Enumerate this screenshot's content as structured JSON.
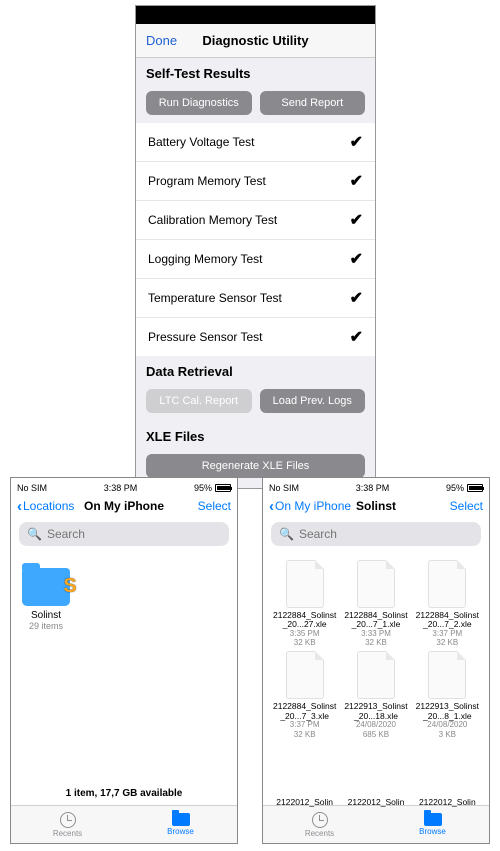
{
  "diag": {
    "done": "Done",
    "title": "Diagnostic Utility",
    "section1": "Self-Test Results",
    "run_btn": "Run Diagnostics",
    "send_btn": "Send Report",
    "tests": [
      "Battery Voltage Test",
      "Program Memory Test",
      "Calibration Memory Test",
      "Logging Memory Test",
      "Temperature Sensor Test",
      "Pressure Sensor Test"
    ],
    "check": "✔",
    "section2": "Data Retrieval",
    "ltc_btn": "LTC Cal. Report",
    "load_btn": "Load Prev. Logs",
    "section3": "XLE Files",
    "regen_btn": "Regenerate XLE Files"
  },
  "status": {
    "sim": "No SIM",
    "time": "3:38 PM",
    "batt": "95%"
  },
  "filesLeft": {
    "back": "Locations",
    "title": "On My iPhone",
    "select": "Select",
    "search_ph": "Search",
    "folder_name": "Solinst",
    "folder_count": "29 items",
    "footer": "1 item, 17,7 GB available"
  },
  "filesRight": {
    "back": "On My iPhone",
    "title": "Solinst",
    "select": "Select",
    "search_ph": "Search",
    "files": [
      {
        "name": "2122884_Solinst_20...27.xle",
        "meta": "3:35 PM",
        "size": "32 KB"
      },
      {
        "name": "2122884_Solinst_20...7_1.xle",
        "meta": "3:33 PM",
        "size": "32 KB"
      },
      {
        "name": "2122884_Solinst_20...7_2.xle",
        "meta": "3:37 PM",
        "size": "32 KB"
      },
      {
        "name": "2122884_Solinst_20...7_3.xle",
        "meta": "3:37 PM",
        "size": "32 KB"
      },
      {
        "name": "2122913_Solinst_20...18.xle",
        "meta": "24/08/2020",
        "size": "685 KB"
      },
      {
        "name": "2122913_Solinst_20...8_1.xle",
        "meta": "24/08/2020",
        "size": "3 KB"
      }
    ],
    "peek": [
      "2122012_Solin",
      "2122012_Solin",
      "2122012_Solin"
    ]
  },
  "tabs": {
    "recents": "Recents",
    "browse": "Browse"
  }
}
